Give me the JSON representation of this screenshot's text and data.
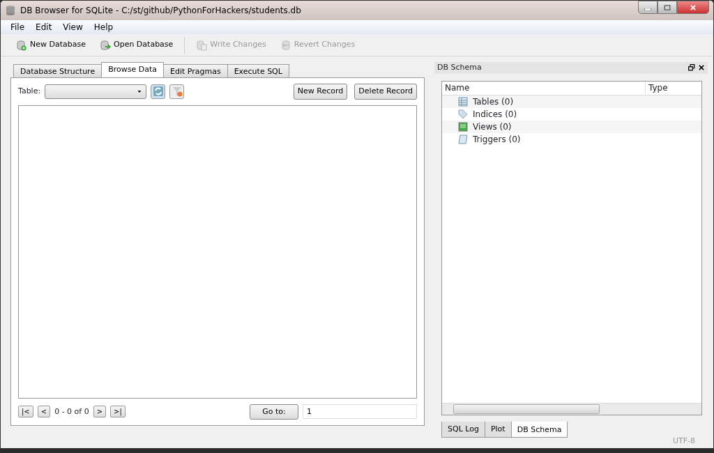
{
  "window": {
    "title": "DB Browser for SQLite - C:/st/github/PythonForHackers/students.db"
  },
  "menu": [
    "File",
    "Edit",
    "View",
    "Help"
  ],
  "toolbar": [
    {
      "label": "New Database",
      "kind": "new",
      "disabled": false
    },
    {
      "label": "Open Database",
      "kind": "open",
      "disabled": false
    },
    {
      "label": "Write Changes",
      "kind": "write",
      "disabled": true
    },
    {
      "label": "Revert Changes",
      "kind": "revert",
      "disabled": true
    }
  ],
  "tabs": [
    {
      "label": "Database Structure",
      "selected": false
    },
    {
      "label": "Browse Data",
      "selected": true
    },
    {
      "label": "Edit Pragmas",
      "selected": false
    },
    {
      "label": "Execute SQL",
      "selected": false
    }
  ],
  "browse": {
    "table_label": "Table:",
    "buttons": [
      "New Record",
      "Delete Record"
    ],
    "first": "|<",
    "prev": "<",
    "range": "0 - 0 of 0",
    "next": ">",
    "last": ">|",
    "goto_button": "Go to:",
    "goto_value": "1"
  },
  "dock": {
    "title": "DB Schema",
    "columns": [
      "Name",
      "Type"
    ],
    "items": [
      {
        "label": "Tables (0)",
        "kind": "table"
      },
      {
        "label": "Indices (0)",
        "kind": "index"
      },
      {
        "label": "Views (0)",
        "kind": "view"
      },
      {
        "label": "Triggers (0)",
        "kind": "trigger"
      }
    ],
    "tabs": [
      {
        "label": "SQL Log",
        "selected": false
      },
      {
        "label": "Plot",
        "selected": false
      },
      {
        "label": "DB Schema",
        "selected": true
      }
    ]
  },
  "status": "UTF-8"
}
